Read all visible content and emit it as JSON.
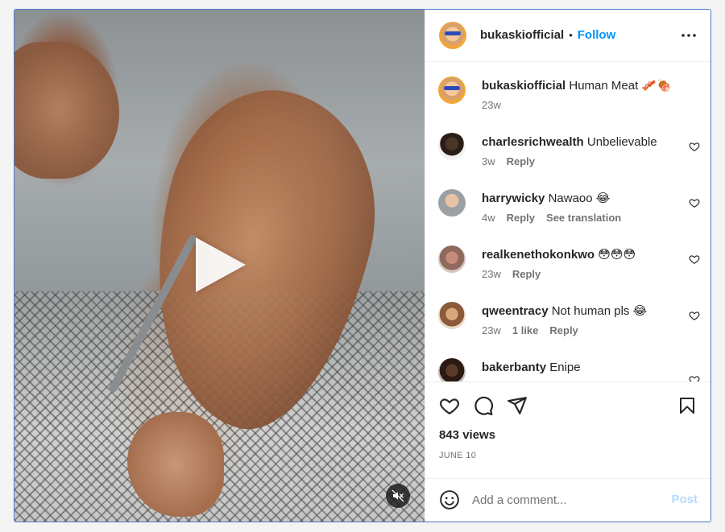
{
  "post": {
    "username": "bukaskiofficial",
    "follow_label": "Follow",
    "dot": "•",
    "caption_user": "bukaskiofficial",
    "caption_text": "Human Meat 🥓🍖",
    "caption_time": "23w"
  },
  "comments": [
    {
      "user": "charlesrichwealth",
      "text": "Unbelievable",
      "time": "3w",
      "actions": [
        "Reply"
      ]
    },
    {
      "user": "harrywicky",
      "text": "Nawaoo 😂",
      "time": "4w",
      "actions": [
        "Reply",
        "See translation"
      ]
    },
    {
      "user": "realkenethokonkwo",
      "text": "😳😳😳",
      "time": "23w",
      "actions": [
        "Reply"
      ]
    },
    {
      "user": "qweentracy",
      "text": "Not human pls 😂",
      "time": "23w",
      "actions": [
        "1 like",
        "Reply"
      ]
    },
    {
      "user": "bakerbanty",
      "text": "Enipe",
      "time": "",
      "actions": []
    }
  ],
  "stats": {
    "views": "843 views",
    "date": "JUNE 10"
  },
  "composer": {
    "placeholder": "Add a comment...",
    "post_label": "Post"
  },
  "icons": {
    "more": "more-horizontal-icon",
    "heart": "heart-icon",
    "comment": "comment-icon",
    "share": "paper-plane-icon",
    "save": "bookmark-icon",
    "emoji": "emoji-icon",
    "play": "play-icon",
    "mute": "muted-speaker-icon"
  },
  "colors": {
    "accent": "#0095f6",
    "post_disabled": "#b3dbff",
    "frame_border": "#4a78c9"
  }
}
